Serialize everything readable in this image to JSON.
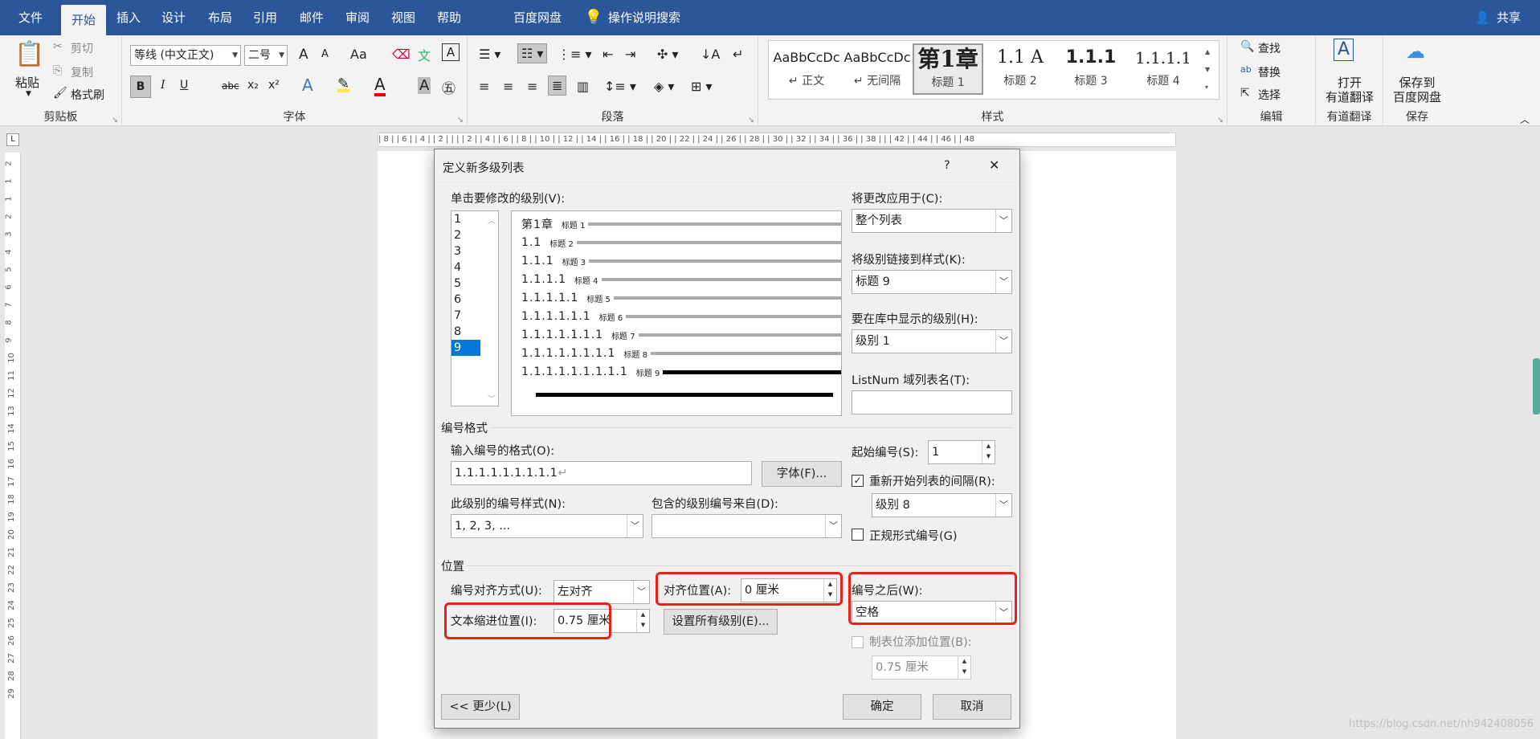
{
  "menu": {
    "tabs": [
      "文件",
      "开始",
      "插入",
      "设计",
      "布局",
      "引用",
      "邮件",
      "审阅",
      "视图",
      "帮助",
      "百度网盘"
    ],
    "search": "操作说明搜索",
    "share": "共享"
  },
  "ribbon": {
    "clipboard": {
      "paste": "粘贴",
      "cut": "剪切",
      "copy": "复制",
      "format_painter": "格式刷",
      "label": "剪贴板"
    },
    "font": {
      "name": "等线 (中文正文)",
      "size": "二号",
      "label": "字体",
      "grow": "A",
      "shrink": "A",
      "case": "Aa",
      "bold": "B",
      "italic": "I",
      "underline": "U",
      "strike": "abc",
      "sub": "x₂",
      "sup": "x²"
    },
    "paragraph": {
      "label": "段落"
    },
    "styles": {
      "label": "样式",
      "items": [
        {
          "preview": "AaBbCcDc",
          "name": "↵ 正文"
        },
        {
          "preview": "AaBbCcDc",
          "name": "↵ 无间隔"
        },
        {
          "preview": "第1章",
          "name": "标题 1"
        },
        {
          "preview": "1.1  A",
          "name": "标题 2"
        },
        {
          "preview": "1.1.1",
          "name": "标题 3"
        },
        {
          "preview": "1.1.1.1",
          "name": "标题 4"
        }
      ]
    },
    "editing": {
      "find": "查找",
      "replace": "替换",
      "select": "选择",
      "label": "编辑"
    },
    "translate": {
      "line1": "打开",
      "line2": "有道翻译",
      "label": "有道翻译"
    },
    "save": {
      "line1": "保存到",
      "line2": "百度网盘",
      "label": "保存"
    }
  },
  "ruler": {
    "ticks": "| 8 |  | 6 |  | 4 |  | 2 |  |  |  | 2 |  | 4 |  | 6 |  | 8 |  | 10 |  | 12 |  | 14 |  | 16 |  | 18 |  | 20 |  | 22 |  | 24 |  | 26 |  | 28 |  | 30 |  | 32 |  | 34 |  | 36 |  | 38 |  |  | 42 |  | 44 |  | 46 |  | 48"
  },
  "vruler": [
    "2",
    "1",
    "1",
    "2",
    "3",
    "4",
    "5",
    "6",
    "7",
    "8",
    "9",
    "10",
    "11",
    "12",
    "13",
    "14",
    "15",
    "16",
    "17",
    "18",
    "19",
    "20",
    "21",
    "22",
    "23",
    "24",
    "25",
    "26",
    "27",
    "28",
    "29"
  ],
  "dialog": {
    "title": "定义新多级列表",
    "help": "?",
    "close": "✕",
    "level_label": "单击要修改的级别(V):",
    "levels": [
      "1",
      "2",
      "3",
      "4",
      "5",
      "6",
      "7",
      "8",
      "9"
    ],
    "selected_level": "9",
    "preview": [
      {
        "num": "第1章",
        "style": "标题 1"
      },
      {
        "num": "1.1",
        "style": "标题 2"
      },
      {
        "num": "1.1.1",
        "style": "标题 3"
      },
      {
        "num": "1.1.1.1",
        "style": "标题 4"
      },
      {
        "num": "1.1.1.1.1",
        "style": "标题 5"
      },
      {
        "num": "1.1.1.1.1.1",
        "style": "标题 6"
      },
      {
        "num": "1.1.1.1.1.1.1",
        "style": "标题 7"
      },
      {
        "num": "1.1.1.1.1.1.1.1",
        "style": "标题 8"
      },
      {
        "num": "1.1.1.1.1.1.1.1.1",
        "style": "标题 9"
      }
    ],
    "apply_to_label": "将更改应用于(C):",
    "apply_to": "整个列表",
    "link_style_label": "将级别链接到样式(K):",
    "link_style": "标题 9",
    "gallery_level_label": "要在库中显示的级别(H):",
    "gallery_level": "级别 1",
    "listnum_label": "ListNum 域列表名(T):",
    "listnum": "",
    "number_format_section": "编号格式",
    "enter_format_label": "输入编号的格式(O):",
    "format_value": "1.1.1.1.1.1.1.1.1",
    "font_button": "字体(F)...",
    "number_style_label": "此级别的编号样式(N):",
    "number_style": "1, 2, 3, ...",
    "include_from_label": "包含的级别编号来自(D):",
    "include_from": "",
    "start_at_label": "起始编号(S):",
    "start_at": "1",
    "restart_label": "重新开始列表的间隔(R):",
    "restart_checked": "✓",
    "restart_value": "级别 8",
    "legal_label": "正规形式编号(G)",
    "position_section": "位置",
    "alignment_label": "编号对齐方式(U):",
    "alignment": "左对齐",
    "aligned_at_label": "对齐位置(A):",
    "aligned_at": "0 厘米",
    "follow_label": "编号之后(W):",
    "follow": "空格",
    "indent_label": "文本缩进位置(I):",
    "indent": "0.75 厘米",
    "set_all_button": "设置所有级别(E)...",
    "tab_stop_label": "制表位添加位置(B):",
    "tab_stop": "0.75 厘米",
    "less_button": "<< 更少(L)",
    "ok_button": "确定",
    "cancel_button": "取消"
  },
  "watermark": "https://blog.csdn.net/nh942408056"
}
